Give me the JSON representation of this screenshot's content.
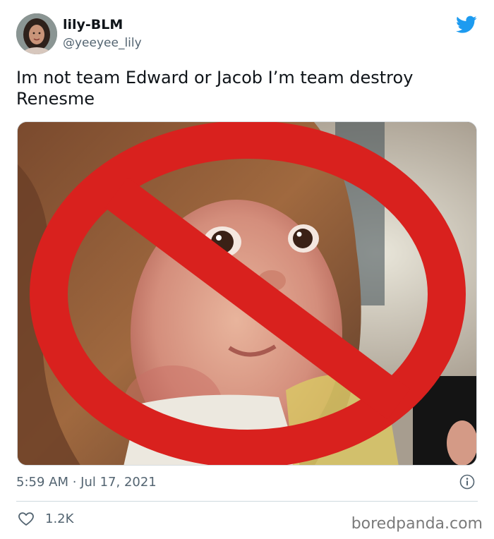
{
  "tweet": {
    "display_name": "lily-BLM",
    "handle": "@yeeyee_lily",
    "text": "Im not team Edward or Jacob I’m team destroy Renesme",
    "timestamp": "5:59 AM · Jul 17, 2021",
    "likes": "1.2K"
  },
  "icons": {
    "platform": "twitter-bird-icon",
    "info": "info-icon",
    "like": "heart-icon",
    "media_overlay": "prohibition-sign-icon"
  },
  "colors": {
    "twitter_blue": "#1d9bf0",
    "prohibition_red": "#d9211e",
    "muted_text": "#536471"
  },
  "watermark": "boredpanda.com"
}
